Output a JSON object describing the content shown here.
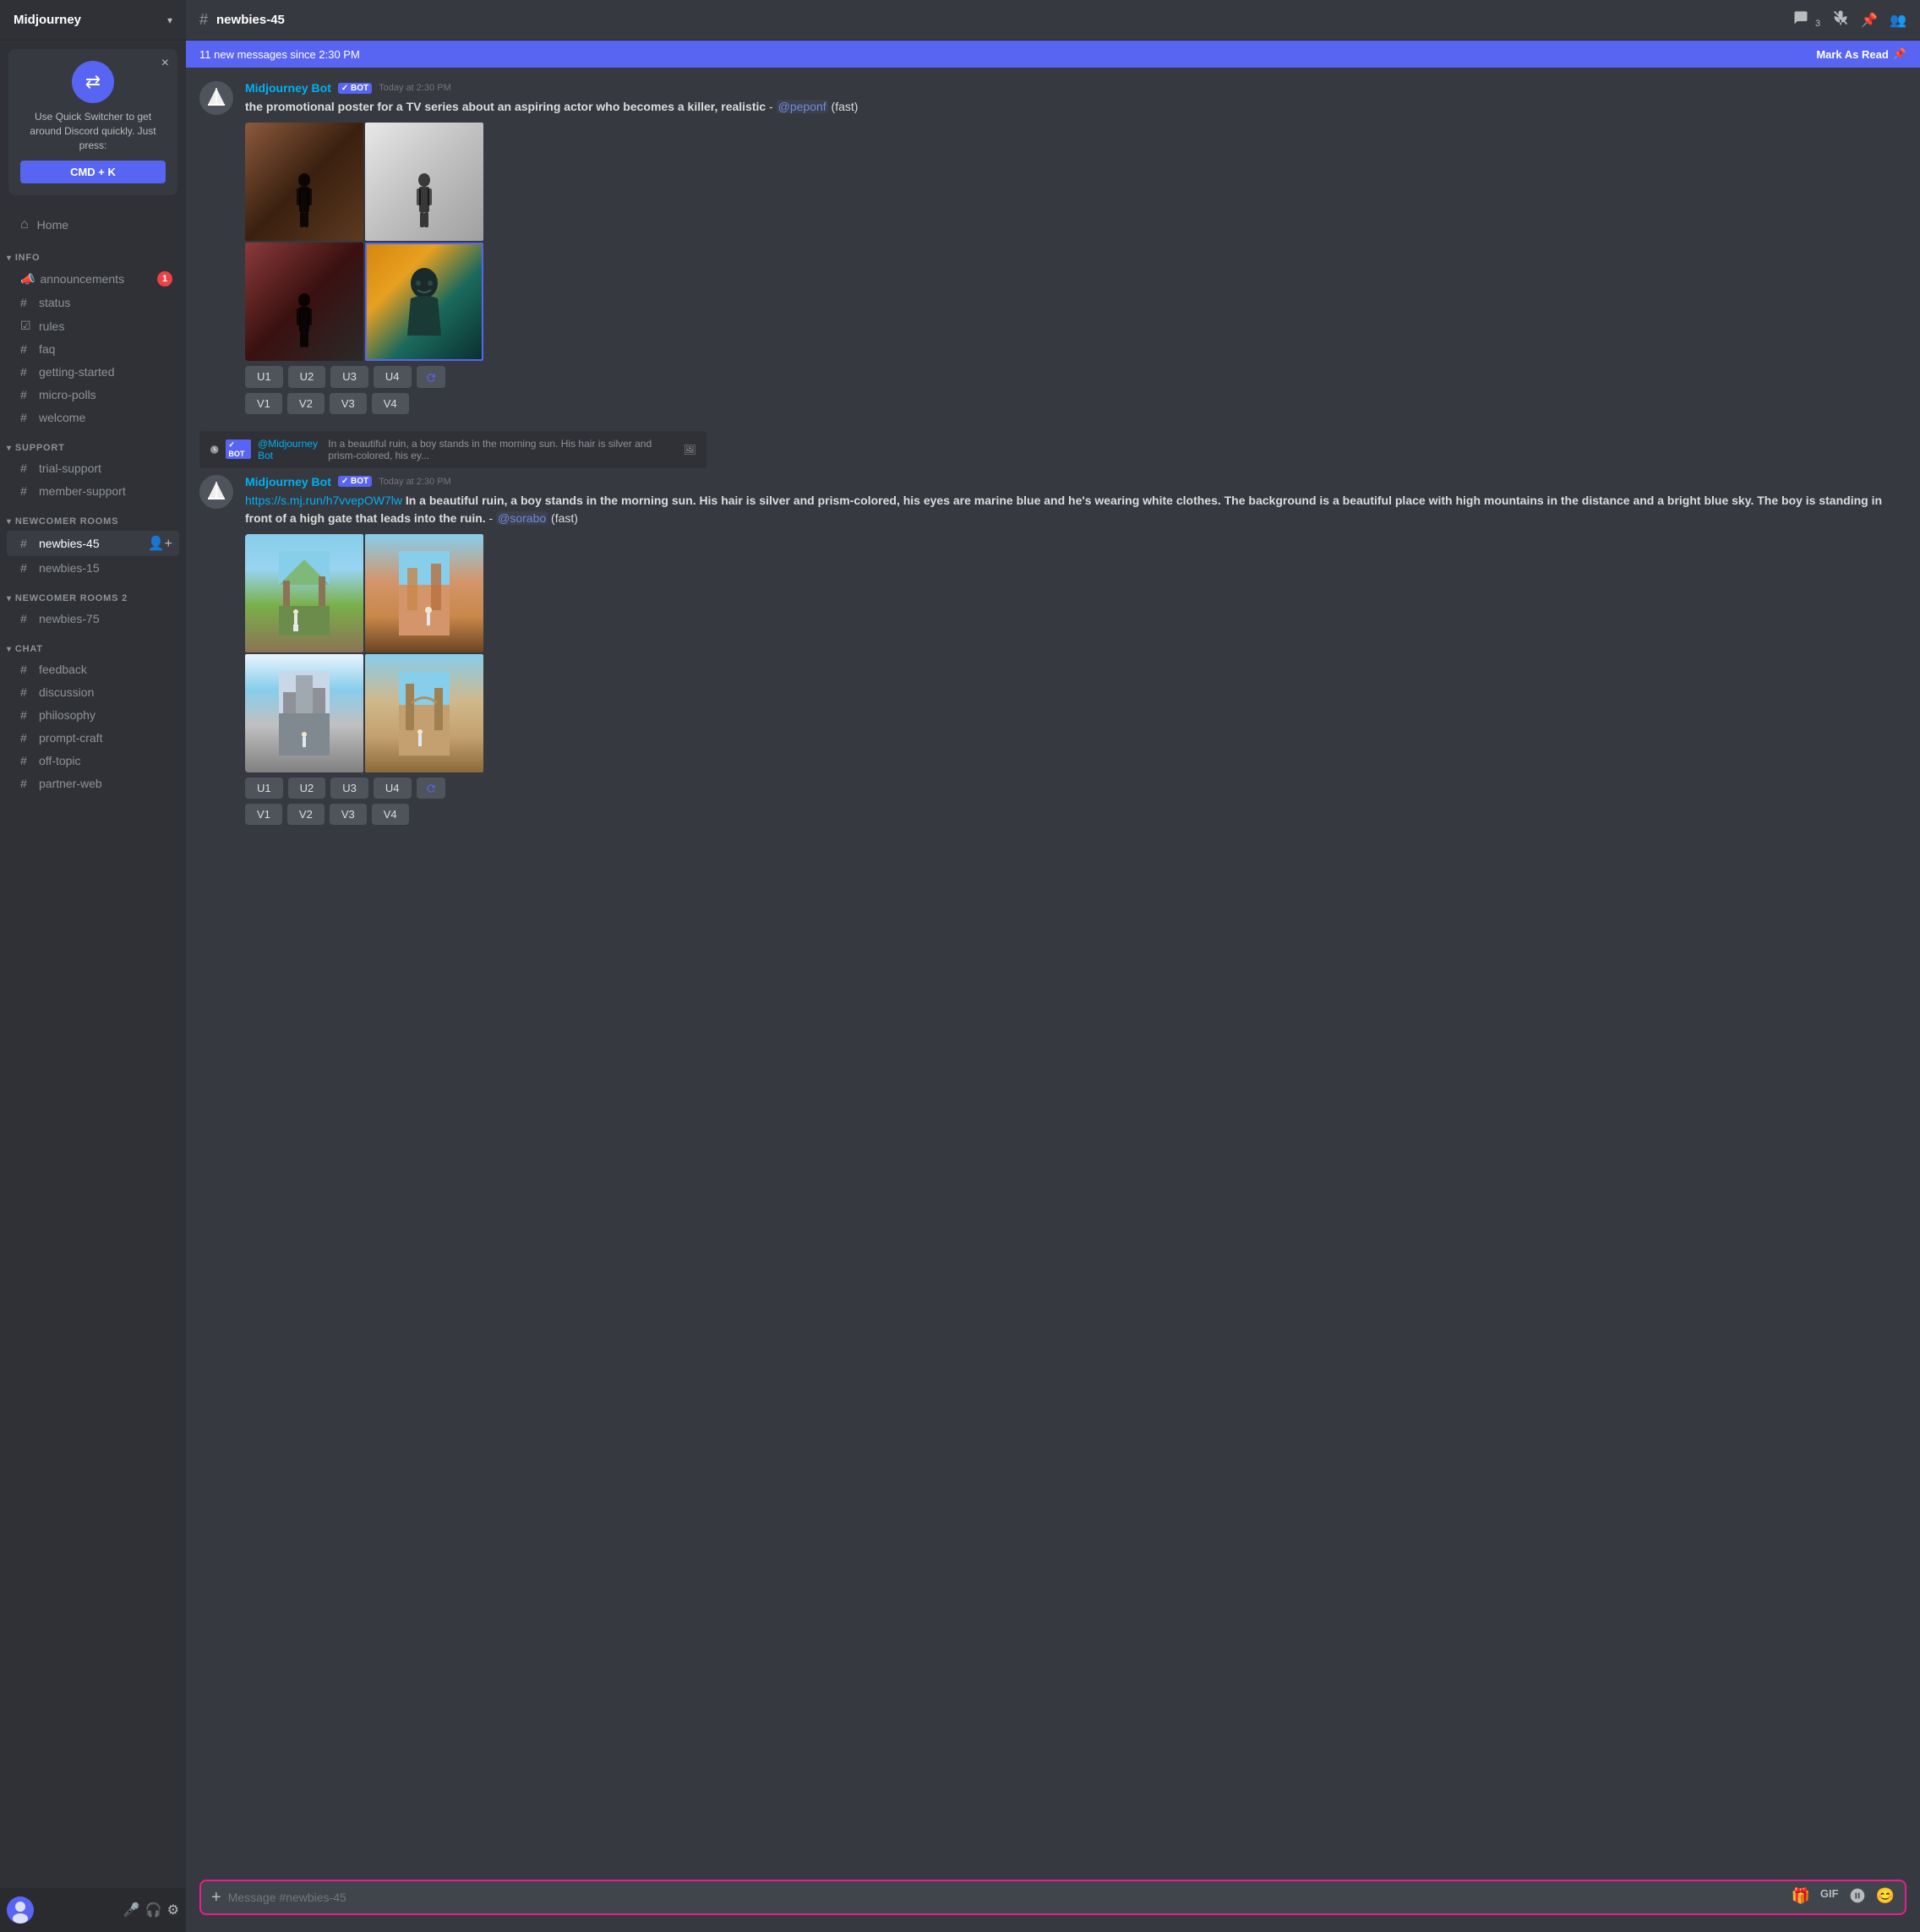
{
  "server": {
    "name": "Midjourney",
    "arrow": "▾"
  },
  "quick_switcher": {
    "close_label": "×",
    "icon": "⇄",
    "description": "Use Quick Switcher to get around Discord quickly. Just press:",
    "shortcut": "CMD + K"
  },
  "sidebar": {
    "home": {
      "label": "Home",
      "icon": "⌂"
    },
    "categories": [
      {
        "name": "INFO",
        "channels": [
          {
            "type": "megaphone",
            "name": "announcements",
            "badge": "1",
            "icon": "📣"
          },
          {
            "type": "hash",
            "name": "status",
            "icon": "#"
          },
          {
            "type": "checkbox",
            "name": "rules",
            "icon": "☑"
          },
          {
            "type": "hash",
            "name": "faq",
            "icon": "#"
          },
          {
            "type": "hash",
            "name": "getting-started",
            "icon": "#"
          },
          {
            "type": "hash",
            "name": "micro-polls",
            "icon": "#"
          },
          {
            "type": "hash",
            "name": "welcome",
            "icon": "#"
          }
        ]
      },
      {
        "name": "SUPPORT",
        "channels": [
          {
            "type": "hash",
            "name": "trial-support",
            "icon": "#"
          },
          {
            "type": "hash",
            "name": "member-support",
            "icon": "#"
          }
        ]
      },
      {
        "name": "NEWCOMER ROOMS",
        "channels": [
          {
            "type": "hash",
            "name": "newbies-45",
            "icon": "#",
            "active": true,
            "add_icon": true
          },
          {
            "type": "hash",
            "name": "newbies-15",
            "icon": "#"
          }
        ]
      },
      {
        "name": "NEWCOMER ROOMS 2",
        "channels": [
          {
            "type": "hash",
            "name": "newbies-75",
            "icon": "#"
          }
        ]
      },
      {
        "name": "CHAT",
        "channels": [
          {
            "type": "hash",
            "name": "feedback",
            "icon": "#"
          },
          {
            "type": "hash",
            "name": "discussion",
            "icon": "#"
          },
          {
            "type": "hash",
            "name": "philosophy",
            "icon": "#"
          },
          {
            "type": "hash",
            "name": "prompt-craft",
            "icon": "#"
          },
          {
            "type": "hash",
            "name": "off-topic",
            "icon": "#"
          },
          {
            "type": "hash",
            "name": "partner-web",
            "icon": "#"
          }
        ]
      }
    ]
  },
  "channel_header": {
    "hash": "#",
    "name": "newbies-45",
    "thread_count": "3",
    "icons": [
      "thread",
      "mute",
      "pin",
      "members"
    ]
  },
  "banner": {
    "text": "11 new messages since 2:30 PM",
    "action": "Mark As Read",
    "action_icon": "📌"
  },
  "messages": [
    {
      "id": "msg1",
      "author": "Midjourney Bot",
      "is_bot": true,
      "bot_label": "BOT",
      "time": "Today at 2:30 PM",
      "text": "the promotional poster for a TV series about an aspiring actor who becomes a killer, realistic - ",
      "mention": "@peponf",
      "suffix": " (fast)",
      "has_images": true,
      "image_type": "tv",
      "action_rows": [
        [
          "U1",
          "U2",
          "U3",
          "U4",
          "🔄"
        ],
        [
          "V1",
          "V2",
          "V3",
          "V4"
        ]
      ]
    },
    {
      "id": "msg2_reply",
      "is_reply_preview": true,
      "reply_bot_label": "BOT",
      "reply_author": "@Midjourney Bot",
      "reply_text": "In a beautiful ruin, a boy stands in the morning sun. His hair is silver and prism-colored, his ey...",
      "reply_icon": "🖼"
    },
    {
      "id": "msg2",
      "author": "Midjourney Bot",
      "is_bot": true,
      "bot_label": "BOT",
      "time": "Today at 2:30 PM",
      "link": "https://s.mj.run/h7vvepOW7lw",
      "text": " In a beautiful ruin, a boy stands in the morning sun. His hair is silver and prism-colored, his eyes are marine blue and he's wearing white clothes. The background is a beautiful place with high mountains in the distance and a bright blue sky. The boy is standing in front of a high gate that leads into the ruin. - ",
      "mention": "@sorabo",
      "suffix": " (fast)",
      "has_images": true,
      "image_type": "castle",
      "action_rows": [
        [
          "U1",
          "U2",
          "U3",
          "U4",
          "🔄"
        ],
        [
          "V1",
          "V2",
          "V3",
          "V4"
        ]
      ]
    }
  ],
  "input": {
    "placeholder": "Message #newbies-45",
    "plus_icon": "+",
    "icons": [
      "gift",
      "gif",
      "sticker",
      "emoji"
    ]
  },
  "footer": {
    "mute_icon": "🎤",
    "headset_icon": "🎧",
    "settings_icon": "⚙"
  }
}
